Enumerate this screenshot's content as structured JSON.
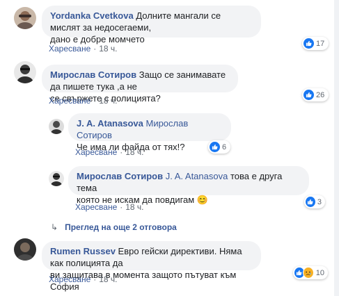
{
  "comments": [
    {
      "author": "Yordanka Cvetkova",
      "mention": "",
      "text_line1": "Долните мангали се мислят за недосегаеми,",
      "text_line2": "дано е добре момчето",
      "like_label": "Харесване",
      "time": "18 ч.",
      "reaction_count": "17"
    },
    {
      "author": "Мирослав Сотиров",
      "mention": "",
      "text_line1": "Защо се занимавате да пишете тука ,а не",
      "text_line2": "се свържете с полицията?",
      "like_label": "Харесване",
      "time": "18 ч.",
      "reaction_count": "26"
    },
    {
      "author": "J. A. Atanasova",
      "mention": "Мирослав Сотиров",
      "text_line1": "",
      "text_line2": "Че има ли файда от тях!?",
      "like_label": "Харесване",
      "time": "18 ч.",
      "reaction_count": "6"
    },
    {
      "author": "Мирослав Сотиров",
      "mention": "J. A. Atanasova",
      "text_line1": "това е друга тема",
      "text_line2": "която не искам да повдигам",
      "emoji": "😊",
      "like_label": "Харесване",
      "time": "18 ч.",
      "reaction_count": "3"
    },
    {
      "author": "Rumen Russev",
      "mention": "",
      "text_line1": "Евро гейски директиви. Няма как полицията да",
      "text_line2": "ви защитава в момента защото пътуват към София",
      "like_label": "Харесване",
      "time": "18 ч.",
      "reaction_count": "10"
    }
  ],
  "view_more_replies": "Преглед на още 2 отговора",
  "colors": {
    "author": "#385898",
    "bubble": "#f2f3f5",
    "like_reaction": "#1877f2",
    "sad_reaction": "#f7b125",
    "meta": "#606770"
  },
  "icons": [
    "like-reaction-icon",
    "sad-reaction-icon",
    "reply-arrow-icon",
    "emoji-smile-icon"
  ]
}
